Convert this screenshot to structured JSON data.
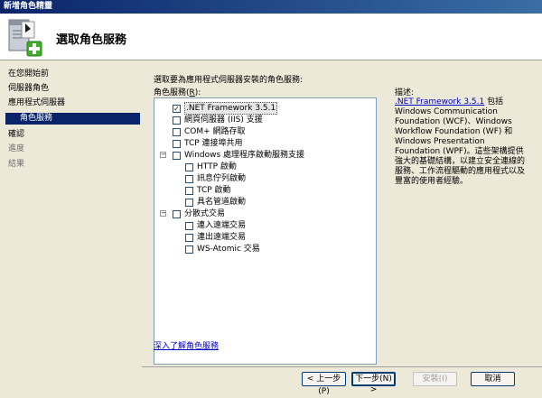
{
  "window": {
    "title": "新增角色精靈"
  },
  "banner": {
    "heading": "選取角色服務",
    "icon": "server-wizard-icon"
  },
  "nav": {
    "items": [
      {
        "label": "在您開始前",
        "state": "normal"
      },
      {
        "label": "伺服器角色",
        "state": "normal"
      },
      {
        "label": "應用程式伺服器",
        "state": "normal"
      },
      {
        "label": "角色服務",
        "state": "active"
      },
      {
        "label": "確認",
        "state": "normal"
      },
      {
        "label": "進度",
        "state": "disabled"
      },
      {
        "label": "結果",
        "state": "disabled"
      }
    ]
  },
  "main": {
    "instruction": "選取要為應用程式伺服器安裝的角色服務:",
    "roles_label": "角色服務(",
    "roles_label_key": "R",
    "roles_label_end": "):",
    "tree": [
      {
        "label": ".NET Framework 3.5.1",
        "checked": true,
        "level": 0,
        "selected": true
      },
      {
        "label": "網頁伺服器 (IIS) 支援",
        "checked": false,
        "level": 0
      },
      {
        "label": "COM+ 網路存取",
        "checked": false,
        "level": 0
      },
      {
        "label": "TCP 連接埠共用",
        "checked": false,
        "level": 0
      },
      {
        "label": "Windows 處理程序啟動服務支援",
        "checked": false,
        "level": 0,
        "expander": "−"
      },
      {
        "label": "HTTP 啟動",
        "checked": false,
        "level": 1
      },
      {
        "label": "訊息佇列啟動",
        "checked": false,
        "level": 1
      },
      {
        "label": "TCP 啟動",
        "checked": false,
        "level": 1
      },
      {
        "label": "具名管道啟動",
        "checked": false,
        "level": 1
      },
      {
        "label": "分散式交易",
        "checked": false,
        "level": 0,
        "expander": "−"
      },
      {
        "label": "連入遠端交易",
        "checked": false,
        "level": 1
      },
      {
        "label": "連出遠端交易",
        "checked": false,
        "level": 1
      },
      {
        "label": "WS-Atomic 交易",
        "checked": false,
        "level": 1
      }
    ],
    "description_label": "描述:",
    "description_link": ".NET Framework 3.5.1",
    "description_text": " 包括 Windows Communication Foundation (WCF)、Windows Workflow Foundation (WF) 和 Windows Presentation Foundation (WPF)。這些架構提供強大的基礎結構，以建立安全連線的服務、工作流程驅動的應用程式以及豐富的使用者經驗。",
    "more_link": "深入了解角色服務"
  },
  "buttons": {
    "back": "< 上一步(P)",
    "next": "下一步(N) >",
    "install": "安裝(I)",
    "cancel": "取消"
  }
}
